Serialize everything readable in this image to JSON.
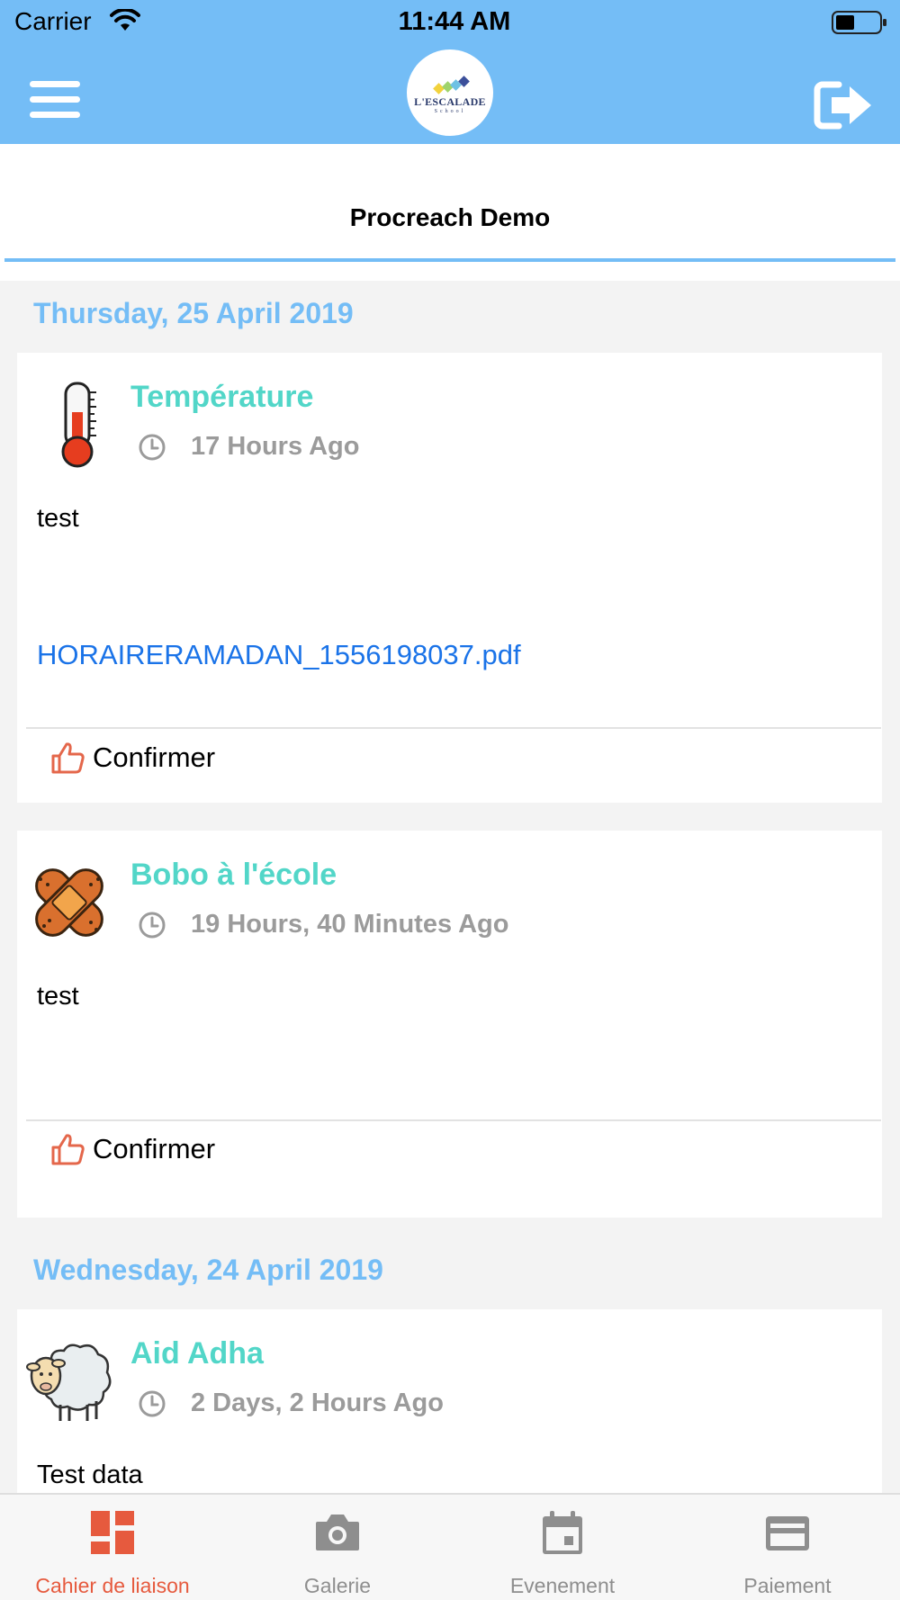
{
  "status_bar": {
    "carrier": "Carrier",
    "time": "11:44 AM"
  },
  "header": {
    "menu_icon": "hamburger-menu-icon",
    "logo": {
      "name": "L'ESCALADE",
      "subtitle": "School"
    },
    "logout_icon": "logout-icon"
  },
  "title": "Procreach Demo",
  "colors": {
    "header_bg": "#74bdf6",
    "date_header": "#74bdf6",
    "card_title": "#52d6c8",
    "link": "#1a73e8",
    "active_tab": "#e65a3e"
  },
  "feed": {
    "groups": [
      {
        "date": "Thursday, 25 April 2019",
        "items": [
          {
            "icon": "thermometer-icon",
            "title": "Température",
            "ago": "17 Hours Ago",
            "body": "test",
            "attachment": "HORAIRERAMADAN_1556198037.pdf",
            "confirm_label": "Confirmer"
          },
          {
            "icon": "bandage-icon",
            "title": "Bobo à l'école",
            "ago": "19 Hours, 40 Minutes Ago",
            "body": "test",
            "confirm_label": "Confirmer"
          }
        ]
      },
      {
        "date": "Wednesday, 24 April 2019",
        "items": [
          {
            "icon": "sheep-icon",
            "title": "Aid Adha",
            "ago": "2 Days, 2 Hours Ago",
            "body": "Test data"
          }
        ]
      }
    ]
  },
  "tabs": [
    {
      "label": "Cahier de liaison",
      "icon": "dashboard-icon",
      "active": true
    },
    {
      "label": "Galerie",
      "icon": "camera-icon",
      "active": false
    },
    {
      "label": "Evenement",
      "icon": "calendar-icon",
      "active": false
    },
    {
      "label": "Paiement",
      "icon": "credit-card-icon",
      "active": false
    }
  ]
}
